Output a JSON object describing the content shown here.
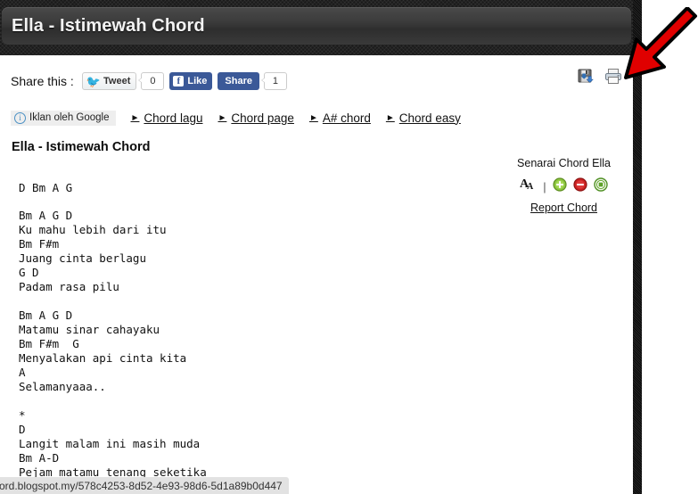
{
  "header": {
    "title": "Ella - Istimewah Chord"
  },
  "share": {
    "label": "Share this :",
    "tweet_label": "Tweet",
    "tweet_count": "0",
    "like_label": "Like",
    "share_label": "Share",
    "share_count": "1",
    "save_icon": "save-floppy-icon",
    "print_icon": "printer-icon"
  },
  "ads": {
    "badge_label": "Iklan oleh Google",
    "badge_icon": "info-circle-icon",
    "links": [
      {
        "label": "Chord lagu"
      },
      {
        "label": "Chord page"
      },
      {
        "label": "A# chord"
      },
      {
        "label": "Chord easy"
      }
    ]
  },
  "song": {
    "heading": "Ella - Istimewah Chord",
    "body": "D Bm A G\n\nBm A G D\nKu mahu lebih dari itu\nBm F#m\nJuang cinta berlagu\nG D\nPadam rasa pilu\n\nBm A G D\nMatamu sinar cahayaku\nBm F#m  G\nMenyalakan api cinta kita\nA\nSelamanyaaa..\n\n*\nD\nLangit malam ini masih muda\nBm A-D\nPejam matamu tenang seketika"
  },
  "side_panel": {
    "senarai_label": "Senarai Chord Ella",
    "font_size_icon": "font-size-aa-icon",
    "separator": "|",
    "increase_icon": "plus-circle-icon",
    "decrease_icon": "minus-circle-icon",
    "reset_icon": "stop-circle-icon",
    "report_label": "Report Chord"
  },
  "annotation": {
    "arrow_icon": "red-arrow-pointer",
    "arrow_color": "#e00000"
  },
  "status_bar": {
    "url_text": "ord.blogspot.my/578c4253-8d52-4e93-98d6-5d1a89b0d447"
  },
  "colors": {
    "header_bar": "#3b3b3b",
    "facebook_blue": "#3b5998",
    "twitter_blue": "#1da1f2",
    "ad_badge_bg": "#eeeeee"
  }
}
